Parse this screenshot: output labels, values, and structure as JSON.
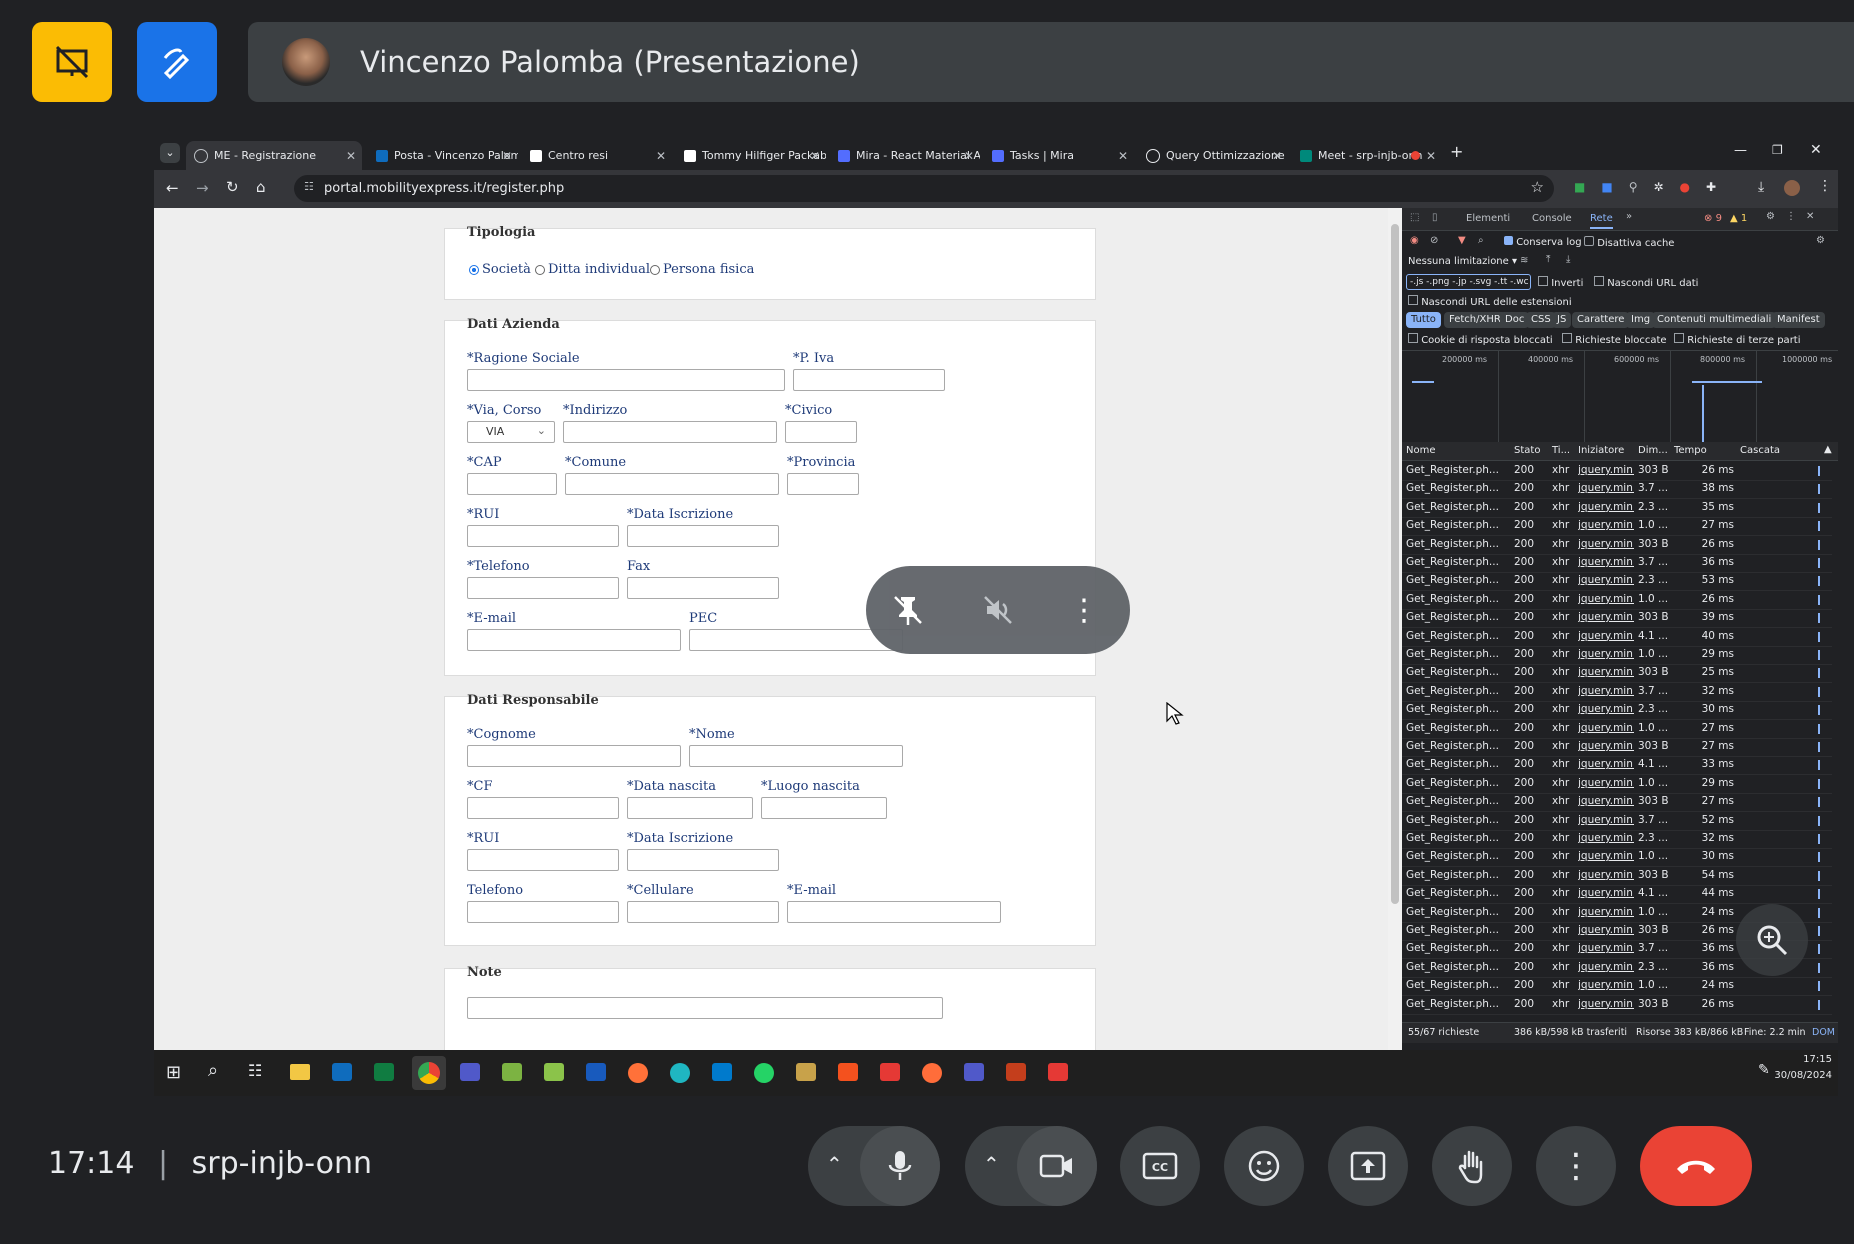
{
  "meet": {
    "presenter_name": "Vincenzo Palomba (Presentazione)",
    "time": "17:14",
    "meeting_code": "srp-injb-onn",
    "accent_yellow": "#fbbc04",
    "accent_blue": "#1a73e8",
    "end_call_color": "#ea4335"
  },
  "browser": {
    "tabs": [
      {
        "label": "ME - Registrazione",
        "icon": "globe-icon"
      },
      {
        "label": "Posta - Vincenzo Palomba",
        "icon": "outlook-icon"
      },
      {
        "label": "Centro resi",
        "icon": "amazon-icon"
      },
      {
        "label": "Tommy Hilfiger Packable",
        "icon": "amazon-icon"
      },
      {
        "label": "Mira - React Material Adm",
        "icon": "mira-icon"
      },
      {
        "label": "Tasks | Mira",
        "icon": "mira-icon"
      },
      {
        "label": "Query Ottimizzazione SQ",
        "icon": "chatgpt-icon"
      },
      {
        "label": "Meet - srp-injb-onn",
        "icon": "meet-icon"
      }
    ],
    "url": "portal.mobilityexpress.it/register.php"
  },
  "form": {
    "tipologia": {
      "legend": "Tipologia",
      "options": [
        "Società",
        "Ditta individuale",
        "Persona fisica"
      ],
      "selected": "Società"
    },
    "azienda": {
      "legend": "Dati Azienda",
      "ragione_sociale": "*Ragione Sociale",
      "piva": "*P. Iva",
      "via_corso": "*Via, Corso",
      "via_value": "VIA",
      "indirizzo": "*Indirizzo",
      "civico": "*Civico",
      "cap": "*CAP",
      "comune": "*Comune",
      "provincia": "*Provincia",
      "rui": "*RUI",
      "data_iscrizione": "*Data Iscrizione",
      "telefono": "*Telefono",
      "fax": "Fax",
      "email": "*E-mail",
      "pec": "PEC"
    },
    "responsabile": {
      "legend": "Dati Responsabile",
      "cognome": "*Cognome",
      "nome": "*Nome",
      "cf": "*CF",
      "data_nascita": "*Data nascita",
      "luogo_nascita": "*Luogo nascita",
      "rui": "*RUI",
      "data_iscrizione": "*Data Iscrizione",
      "telefono": "Telefono",
      "cellulare": "*Cellulare",
      "email": "*E-mail"
    },
    "note": {
      "legend": "Note"
    }
  },
  "devtools": {
    "tabs": [
      "Elementi",
      "Console",
      "Rete"
    ],
    "active_tab": "Rete",
    "errors": "9",
    "warnings": "1",
    "preserve_log": "Conserva log",
    "disable_cache": "Disattiva cache",
    "throttling": "Nessuna limitazione",
    "filter_value": "-.js -.png -.jp -.svg -.tt -.wc",
    "invert": "Inverti",
    "hide_data_urls": "Nascondi URL dati",
    "hide_ext_urls": "Nascondi URL delle estensioni",
    "type_filters": [
      "Tutto",
      "Fetch/XHR",
      "Doc",
      "CSS",
      "JS",
      "Carattere",
      "Img",
      "Contenuti multimediali",
      "Manifest"
    ],
    "blocked_cookies": "Cookie di risposta bloccati",
    "blocked_requests": "Richieste bloccate",
    "third_party": "Richieste di terze parti",
    "timeline_ticks": [
      "200000 ms",
      "400000 ms",
      "600000 ms",
      "800000 ms",
      "1000000 ms"
    ],
    "columns": [
      "Nome",
      "Stato",
      "Ti...",
      "Iniziatore",
      "Dim...",
      "Tempo",
      "Cascata"
    ],
    "rows": [
      {
        "name": "Get_Register.ph...",
        "status": "200",
        "type": "xhr",
        "init": "jquery.min.j",
        "size": "303 B",
        "time": "26 ms"
      },
      {
        "name": "Get_Register.ph...",
        "status": "200",
        "type": "xhr",
        "init": "jquery.min.j",
        "size": "3.7 ...",
        "time": "38 ms"
      },
      {
        "name": "Get_Register.ph...",
        "status": "200",
        "type": "xhr",
        "init": "jquery.min.j",
        "size": "2.3 ...",
        "time": "35 ms"
      },
      {
        "name": "Get_Register.ph...",
        "status": "200",
        "type": "xhr",
        "init": "jquery.min.j",
        "size": "1.0 ...",
        "time": "27 ms"
      },
      {
        "name": "Get_Register.ph...",
        "status": "200",
        "type": "xhr",
        "init": "jquery.min.j",
        "size": "303 B",
        "time": "26 ms"
      },
      {
        "name": "Get_Register.ph...",
        "status": "200",
        "type": "xhr",
        "init": "jquery.min.j",
        "size": "3.7 ...",
        "time": "36 ms"
      },
      {
        "name": "Get_Register.ph...",
        "status": "200",
        "type": "xhr",
        "init": "jquery.min.j",
        "size": "2.3 ...",
        "time": "53 ms"
      },
      {
        "name": "Get_Register.ph...",
        "status": "200",
        "type": "xhr",
        "init": "jquery.min.j",
        "size": "1.0 ...",
        "time": "26 ms"
      },
      {
        "name": "Get_Register.ph...",
        "status": "200",
        "type": "xhr",
        "init": "jquery.min.j",
        "size": "303 B",
        "time": "39 ms"
      },
      {
        "name": "Get_Register.ph...",
        "status": "200",
        "type": "xhr",
        "init": "jquery.min.j",
        "size": "4.1 ...",
        "time": "40 ms"
      },
      {
        "name": "Get_Register.ph...",
        "status": "200",
        "type": "xhr",
        "init": "jquery.min.j",
        "size": "1.0 ...",
        "time": "29 ms"
      },
      {
        "name": "Get_Register.ph...",
        "status": "200",
        "type": "xhr",
        "init": "jquery.min.j",
        "size": "303 B",
        "time": "25 ms"
      },
      {
        "name": "Get_Register.ph...",
        "status": "200",
        "type": "xhr",
        "init": "jquery.min.j",
        "size": "3.7 ...",
        "time": "32 ms"
      },
      {
        "name": "Get_Register.ph...",
        "status": "200",
        "type": "xhr",
        "init": "jquery.min.j",
        "size": "2.3 ...",
        "time": "30 ms"
      },
      {
        "name": "Get_Register.ph...",
        "status": "200",
        "type": "xhr",
        "init": "jquery.min.j",
        "size": "1.0 ...",
        "time": "27 ms"
      },
      {
        "name": "Get_Register.ph...",
        "status": "200",
        "type": "xhr",
        "init": "jquery.min.j",
        "size": "303 B",
        "time": "27 ms"
      },
      {
        "name": "Get_Register.ph...",
        "status": "200",
        "type": "xhr",
        "init": "jquery.min.j",
        "size": "4.1 ...",
        "time": "33 ms"
      },
      {
        "name": "Get_Register.ph...",
        "status": "200",
        "type": "xhr",
        "init": "jquery.min.j",
        "size": "1.0 ...",
        "time": "29 ms"
      },
      {
        "name": "Get_Register.ph...",
        "status": "200",
        "type": "xhr",
        "init": "jquery.min.j",
        "size": "303 B",
        "time": "27 ms"
      },
      {
        "name": "Get_Register.ph...",
        "status": "200",
        "type": "xhr",
        "init": "jquery.min.j",
        "size": "3.7 ...",
        "time": "52 ms"
      },
      {
        "name": "Get_Register.ph...",
        "status": "200",
        "type": "xhr",
        "init": "jquery.min.j",
        "size": "2.3 ...",
        "time": "32 ms"
      },
      {
        "name": "Get_Register.ph...",
        "status": "200",
        "type": "xhr",
        "init": "jquery.min.j",
        "size": "1.0 ...",
        "time": "30 ms"
      },
      {
        "name": "Get_Register.ph...",
        "status": "200",
        "type": "xhr",
        "init": "jquery.min.j",
        "size": "303 B",
        "time": "54 ms"
      },
      {
        "name": "Get_Register.ph...",
        "status": "200",
        "type": "xhr",
        "init": "jquery.min.j",
        "size": "4.1 ...",
        "time": "44 ms"
      },
      {
        "name": "Get_Register.ph...",
        "status": "200",
        "type": "xhr",
        "init": "jquery.min.j",
        "size": "1.0 ...",
        "time": "24 ms"
      },
      {
        "name": "Get_Register.ph...",
        "status": "200",
        "type": "xhr",
        "init": "jquery.min.j",
        "size": "303 B",
        "time": "26 ms"
      },
      {
        "name": "Get_Register.ph...",
        "status": "200",
        "type": "xhr",
        "init": "jquery.min.j",
        "size": "3.7 ...",
        "time": "36 ms"
      },
      {
        "name": "Get_Register.ph...",
        "status": "200",
        "type": "xhr",
        "init": "jquery.min.j",
        "size": "2.3 ...",
        "time": "36 ms"
      },
      {
        "name": "Get_Register.ph...",
        "status": "200",
        "type": "xhr",
        "init": "jquery.min.j",
        "size": "1.0 ...",
        "time": "24 ms"
      },
      {
        "name": "Get_Register.ph...",
        "status": "200",
        "type": "xhr",
        "init": "jquery.min.j",
        "size": "303 B",
        "time": "26 ms"
      }
    ],
    "status_requests": "55/67 richieste",
    "status_transferred": "386 kB/598 kB trasferiti",
    "status_resources": "Risorse 383 kB/866 kB",
    "status_finish": "Fine: 2.2 min",
    "status_dom": "DOM"
  },
  "taskbar": {
    "time": "17:15",
    "date": "30/08/2024"
  }
}
